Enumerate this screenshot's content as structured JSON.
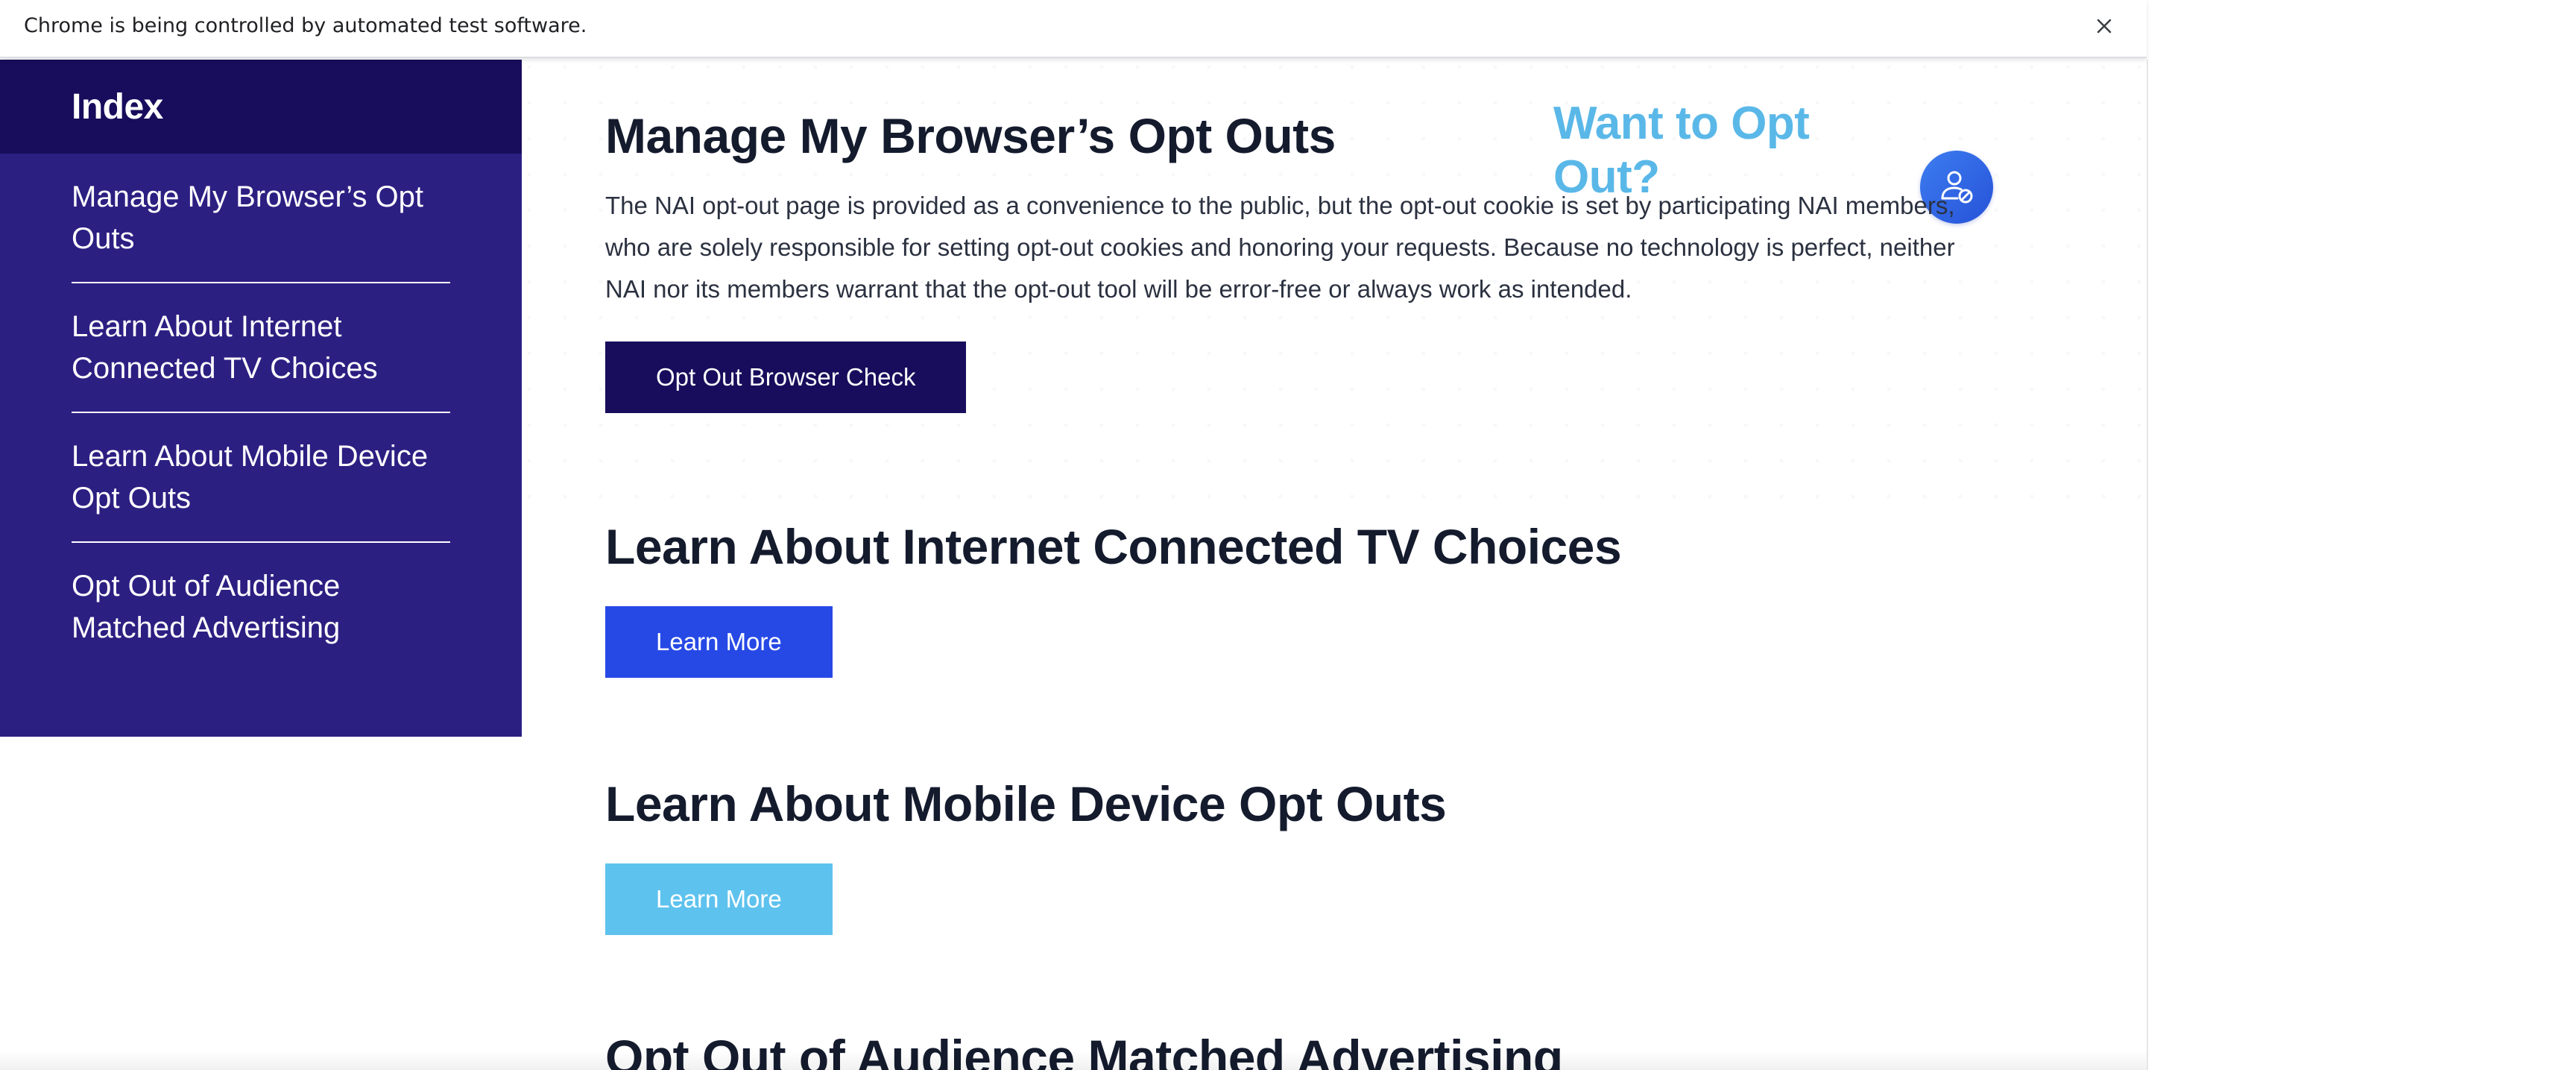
{
  "browser": {
    "infobar_text": "Chrome is being controlled by automated test software.",
    "close_icon": "close-icon"
  },
  "sidebar": {
    "title": "Index",
    "items": [
      {
        "label": "Manage My Browser’s Opt Outs"
      },
      {
        "label": "Learn About Internet Connected TV Choices"
      },
      {
        "label": "Learn About Mobile Device Opt Outs"
      },
      {
        "label": "Opt Out of Audience Matched Advertising"
      }
    ]
  },
  "widget": {
    "heading": "Want to Opt Out?",
    "icon": "user-block-icon",
    "color": "#5ab8e8"
  },
  "sections": [
    {
      "title": "Manage My Browser’s Opt Outs",
      "description": "The NAI opt-out page is provided as a convenience to the public, but the opt-out cookie is set by participating NAI members, who are solely responsible for setting opt-out cookies and honoring your requests. Because no technology is perfect, neither NAI nor its members warrant that the opt-out tool will be error-free or always work as intended.",
      "button": "Opt Out Browser Check"
    },
    {
      "title": "Learn About Internet Connected TV Choices",
      "button": "Learn More"
    },
    {
      "title": "Learn About Mobile Device Opt Outs",
      "button": "Learn More"
    },
    {
      "title": "Opt Out of Audience Matched Advertising"
    }
  ],
  "colors": {
    "sidebar_bg": "#2c1f82",
    "sidebar_header_bg": "#170d5c",
    "button_dark": "#170d5c",
    "button_blue": "#2649e6",
    "button_light": "#5ec2ee"
  }
}
